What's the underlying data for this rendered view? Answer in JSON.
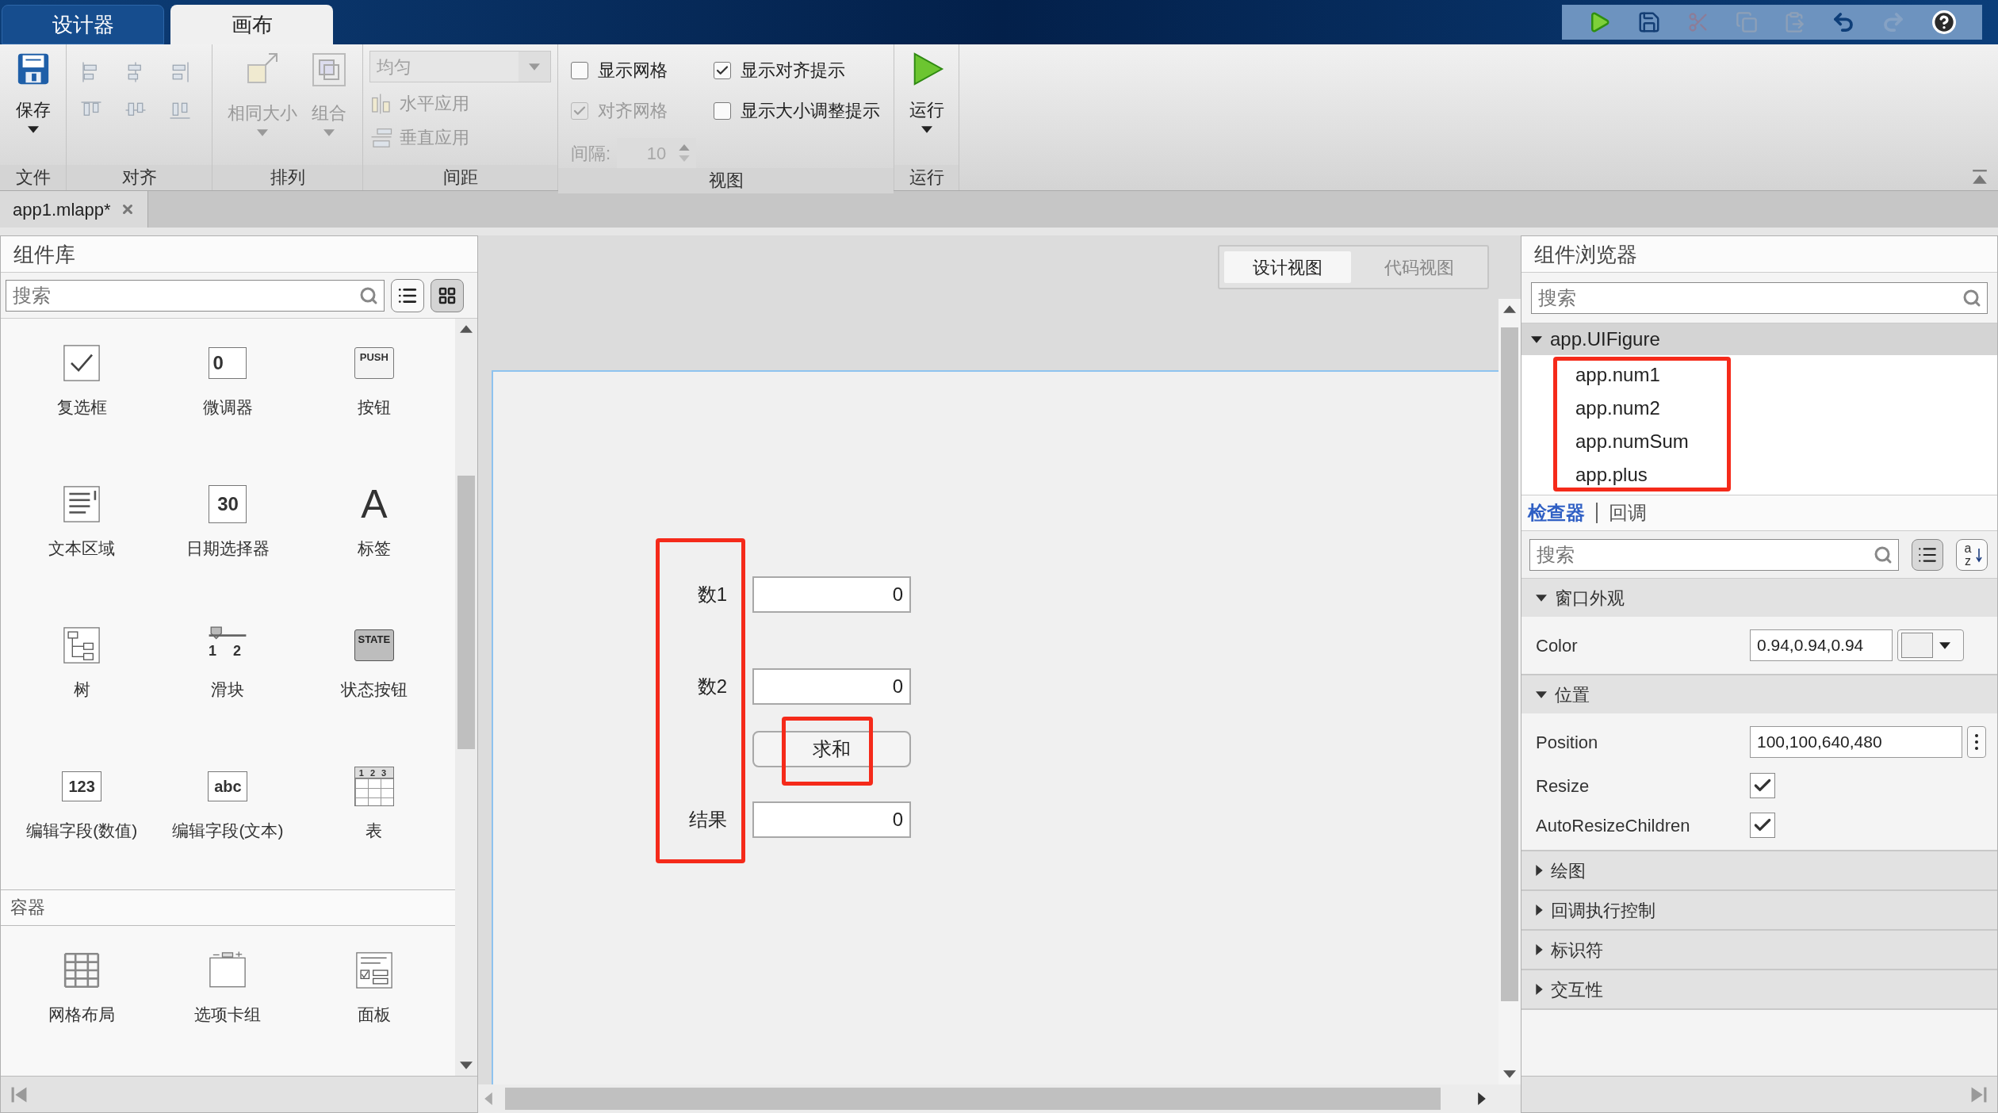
{
  "app_tabs": [
    {
      "label": "设计器",
      "selected": false
    },
    {
      "label": "画布",
      "selected": true
    }
  ],
  "toolstrip": {
    "file": {
      "label": "文件",
      "save": "保存"
    },
    "align": {
      "label": "对齐"
    },
    "arrange": {
      "label": "排列",
      "buttons": [
        {
          "label": "相同大小",
          "disabled": true
        },
        {
          "label": "组合",
          "disabled": true
        }
      ]
    },
    "spacing": {
      "label": "间距",
      "mode": {
        "value": "均匀",
        "disabled": true
      },
      "buttons": [
        {
          "label": "水平应用",
          "disabled": true
        },
        {
          "label": "垂直应用",
          "disabled": true
        }
      ]
    },
    "view": {
      "label": "视图",
      "checkboxes": [
        {
          "label": "显示网格",
          "checked": false,
          "disabled": false
        },
        {
          "label": "显示对齐提示",
          "checked": true,
          "disabled": false
        },
        {
          "label": "对齐网格",
          "checked": true,
          "disabled": true
        },
        {
          "label": "显示大小调整提示",
          "checked": false,
          "disabled": false
        }
      ],
      "interval": {
        "label": "间隔:",
        "value": "10",
        "disabled": true
      }
    },
    "run": {
      "label": "运行",
      "button": "运行"
    }
  },
  "document_tabs": [
    {
      "label": "app1.mlapp*",
      "selected": true
    }
  ],
  "component_library": {
    "title": "组件库",
    "search": {
      "placeholder": "搜索"
    },
    "view_buttons": [
      {
        "kind": "list",
        "selected": false
      },
      {
        "kind": "grid",
        "selected": true
      }
    ],
    "items": [
      {
        "kind": "checkbox",
        "label": "复选框"
      },
      {
        "kind": "spinner",
        "label": "微调器",
        "icon_text": "0"
      },
      {
        "kind": "button",
        "label": "按钮",
        "icon_text": "PUSH"
      },
      {
        "kind": "textarea",
        "label": "文本区域"
      },
      {
        "kind": "datepicker",
        "label": "日期选择器",
        "icon_text": "30"
      },
      {
        "kind": "label",
        "label": "标签",
        "icon_text": "A"
      },
      {
        "kind": "tree",
        "label": "树"
      },
      {
        "kind": "slider",
        "label": "滑块",
        "icon_text": "1 2"
      },
      {
        "kind": "statebutton",
        "label": "状态按钮",
        "icon_text": "STATE"
      },
      {
        "kind": "numericfield",
        "label": "编辑字段(数值)",
        "icon_text": "123"
      },
      {
        "kind": "textfield",
        "label": "编辑字段(文本)",
        "icon_text": "abc"
      },
      {
        "kind": "table",
        "label": "表",
        "icon_text": "123"
      }
    ],
    "sections": [
      {
        "title": "容器",
        "items": [
          {
            "kind": "gridlayout",
            "label": "网格布局"
          },
          {
            "kind": "tabgroup",
            "label": "选项卡组"
          },
          {
            "kind": "panel",
            "label": "面板"
          }
        ]
      }
    ]
  },
  "canvas": {
    "view_tabs": [
      {
        "label": "设计视图",
        "selected": true
      },
      {
        "label": "代码视图",
        "selected": false
      }
    ],
    "components": [
      {
        "kind": "field",
        "label": "数1",
        "value": "0"
      },
      {
        "kind": "field",
        "label": "数2",
        "value": "0"
      },
      {
        "kind": "button",
        "label": "求和"
      },
      {
        "kind": "field",
        "label": "结果",
        "value": "0"
      }
    ]
  },
  "component_browser": {
    "title": "组件浏览器",
    "search": {
      "placeholder": "搜索"
    },
    "tree": [
      {
        "label": "app.UIFigure",
        "expanded": true,
        "children": [
          {
            "label": "app.num1"
          },
          {
            "label": "app.num2"
          },
          {
            "label": "app.numSum"
          },
          {
            "label": "app.plus"
          }
        ]
      }
    ]
  },
  "inspector": {
    "tabs": [
      {
        "label": "检查器",
        "selected": true
      },
      {
        "label": "回调",
        "selected": false
      }
    ],
    "search": {
      "placeholder": "搜索"
    },
    "sort_icon_text": "az",
    "sections": [
      {
        "title": "窗口外观",
        "expanded": true,
        "properties": [
          {
            "kind": "color",
            "name": "Color",
            "value": "0.94,0.94,0.94",
            "color": "#f0f0f0"
          }
        ]
      },
      {
        "title": "位置",
        "expanded": true,
        "properties": [
          {
            "kind": "text",
            "name": "Position",
            "value": "100,100,640,480"
          },
          {
            "kind": "checkbox",
            "name": "Resize",
            "checked": true
          },
          {
            "kind": "checkbox",
            "name": "AutoResizeChildren",
            "checked": true
          }
        ]
      },
      {
        "title": "绘图",
        "expanded": false
      },
      {
        "title": "回调执行控制",
        "expanded": false
      },
      {
        "title": "标识符",
        "expanded": false
      },
      {
        "title": "交互性",
        "expanded": false
      }
    ]
  }
}
